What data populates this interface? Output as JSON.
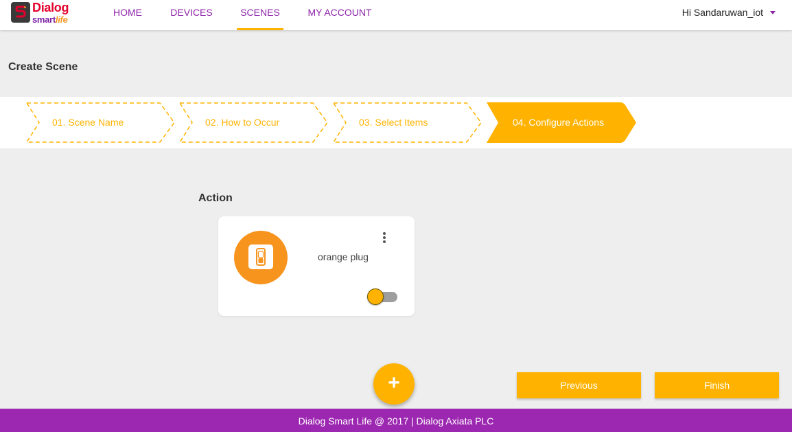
{
  "brand": {
    "name": "Dialog",
    "sub_prefix": "smart",
    "sub_suffix": "life"
  },
  "nav": {
    "home": "HOME",
    "devices": "DEVICES",
    "scenes": "SCENES",
    "account": "MY ACCOUNT",
    "active": "SCENES"
  },
  "user": {
    "greeting": "Hi Sandaruwan_iot",
    "menu_icon": "caret-down-icon"
  },
  "page": {
    "title": "Create Scene"
  },
  "stepper": {
    "steps": [
      {
        "label": "01. Scene Name",
        "state": "inactive"
      },
      {
        "label": "02. How to Occur",
        "state": "inactive"
      },
      {
        "label": "03. Select Items",
        "state": "inactive"
      },
      {
        "label": "04. Configure Actions",
        "state": "active"
      }
    ]
  },
  "action": {
    "section_title": "Action",
    "card": {
      "device_name": "orange plug",
      "device_icon": "smart-plug-icon",
      "menu_icon": "more-vert-icon",
      "toggle_on": false
    }
  },
  "fab": {
    "label": "+",
    "icon": "plus-icon"
  },
  "buttons": {
    "previous": "Previous",
    "finish": "Finish"
  },
  "footer": {
    "text": "Dialog Smart Life @ 2017 | Dialog Axiata PLC"
  },
  "colors": {
    "accent": "#ffb300",
    "nav_text": "#8e24aa",
    "footer_bg": "#9c27b0",
    "device_circle": "#f7941d",
    "background": "#eeeeee"
  }
}
